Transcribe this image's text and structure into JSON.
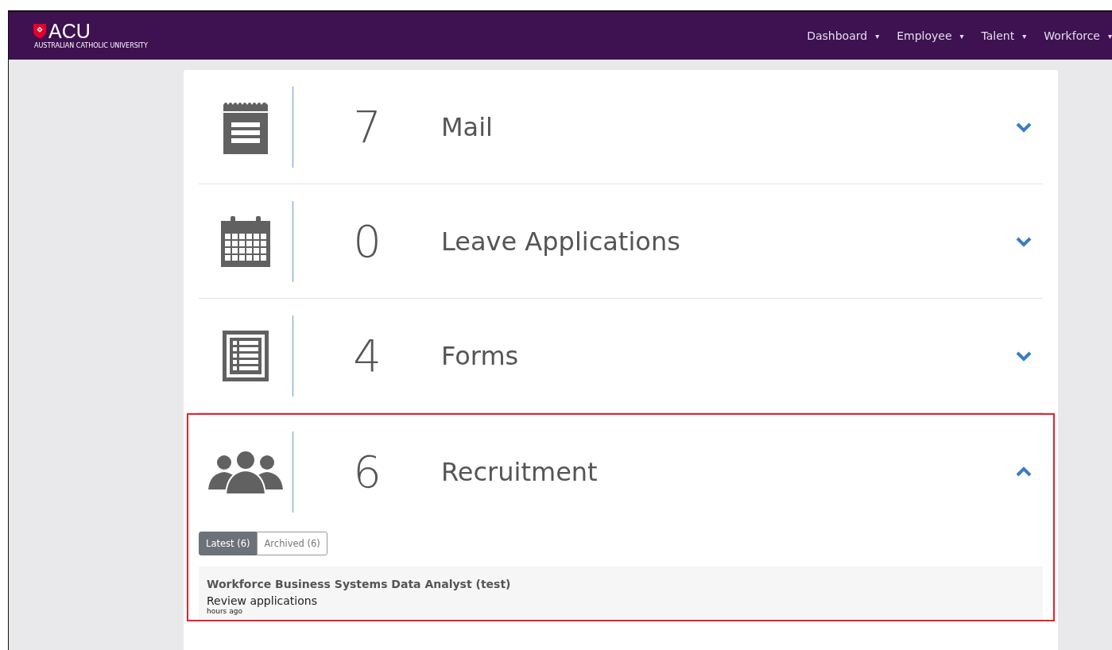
{
  "header": {
    "logo": {
      "name": "ACU",
      "subtitle": "AUSTRALIAN CATHOLIC UNIVERSITY"
    },
    "nav": [
      {
        "label": "Dashboard",
        "caret": "▾"
      },
      {
        "label": "Employee",
        "caret": "▾"
      },
      {
        "label": "Talent",
        "caret": "▾"
      },
      {
        "label": "Workforce",
        "caret": "▾"
      }
    ]
  },
  "sections": [
    {
      "kind": "notepad",
      "count": "7",
      "title": "Mail",
      "expanded": false,
      "highlighted": false
    },
    {
      "kind": "calendar",
      "count": "0",
      "title": "Leave Applications",
      "expanded": false,
      "highlighted": false
    },
    {
      "kind": "list",
      "count": "4",
      "title": "Forms",
      "expanded": false,
      "highlighted": false
    },
    {
      "kind": "people",
      "count": "6",
      "title": "Recruitment",
      "expanded": true,
      "highlighted": true,
      "tabs": [
        {
          "label": "Latest (6)",
          "selected": true
        },
        {
          "label": "Archived (6)",
          "selected": false
        }
      ],
      "items": [
        {
          "title": "Workforce Business Systems Data Analyst (test)",
          "action": "Review applications",
          "time": "hours ago"
        }
      ]
    }
  ]
}
